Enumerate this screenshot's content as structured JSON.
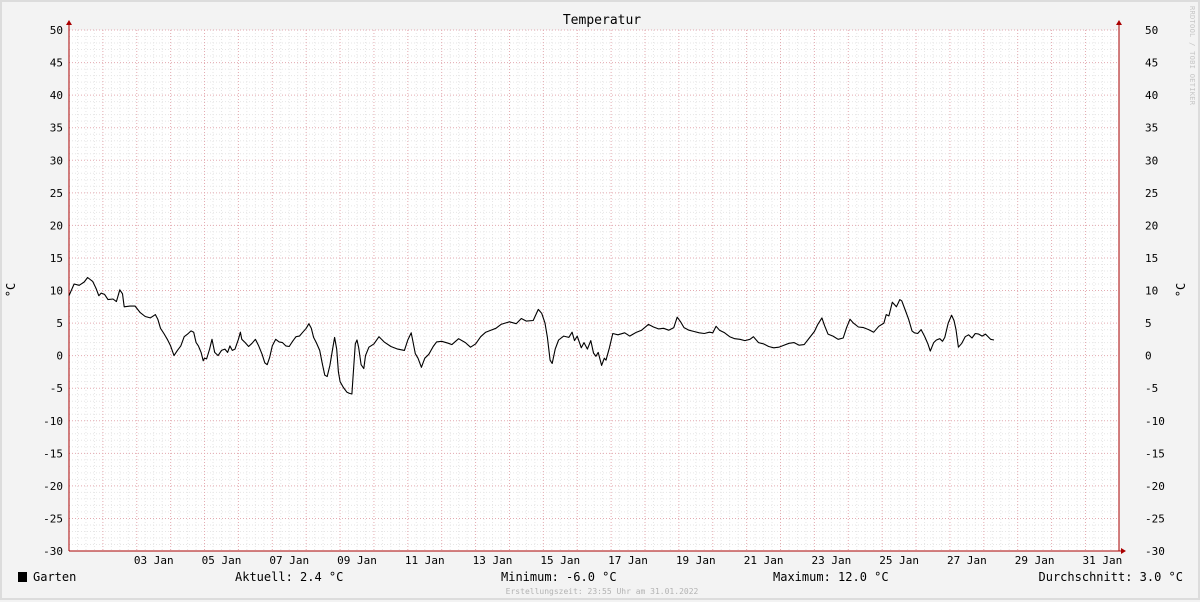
{
  "chart_data": {
    "type": "line",
    "title": "Temperatur",
    "ylabel": "°C",
    "y_ticks": [
      50,
      45,
      40,
      35,
      30,
      25,
      20,
      15,
      10,
      5,
      0,
      -5,
      -10,
      -15,
      -20,
      -25,
      -30
    ],
    "ylim": [
      -30,
      50
    ],
    "xlim": [
      1.0,
      31.99
    ],
    "x_ticks": [
      {
        "day": 3,
        "label": "03 Jan"
      },
      {
        "day": 5,
        "label": "05 Jan"
      },
      {
        "day": 7,
        "label": "07 Jan"
      },
      {
        "day": 9,
        "label": "09 Jan"
      },
      {
        "day": 11,
        "label": "11 Jan"
      },
      {
        "day": 13,
        "label": "13 Jan"
      },
      {
        "day": 15,
        "label": "15 Jan"
      },
      {
        "day": 17,
        "label": "17 Jan"
      },
      {
        "day": 19,
        "label": "19 Jan"
      },
      {
        "day": 21,
        "label": "21 Jan"
      },
      {
        "day": 23,
        "label": "23 Jan"
      },
      {
        "day": 25,
        "label": "25 Jan"
      },
      {
        "day": 27,
        "label": "27 Jan"
      },
      {
        "day": 29,
        "label": "29 Jan"
      },
      {
        "day": 31,
        "label": "31 Jan"
      }
    ],
    "grid": true,
    "series": [
      {
        "name": "Garten",
        "color": "#000000",
        "points": [
          [
            1.0,
            9.2
          ],
          [
            1.15,
            11.0
          ],
          [
            1.3,
            10.8
          ],
          [
            1.45,
            11.3
          ],
          [
            1.55,
            12.0
          ],
          [
            1.7,
            11.4
          ],
          [
            1.8,
            10.3
          ],
          [
            1.88,
            9.2
          ],
          [
            1.95,
            9.6
          ],
          [
            2.05,
            9.4
          ],
          [
            2.15,
            8.6
          ],
          [
            2.3,
            8.7
          ],
          [
            2.4,
            8.3
          ],
          [
            2.5,
            10.1
          ],
          [
            2.58,
            9.5
          ],
          [
            2.63,
            7.5
          ],
          [
            2.8,
            7.6
          ],
          [
            2.95,
            7.6
          ],
          [
            3.1,
            6.6
          ],
          [
            3.25,
            6.0
          ],
          [
            3.4,
            5.8
          ],
          [
            3.55,
            6.3
          ],
          [
            3.62,
            5.6
          ],
          [
            3.7,
            4.2
          ],
          [
            3.8,
            3.4
          ],
          [
            3.9,
            2.5
          ],
          [
            4.0,
            1.5
          ],
          [
            4.1,
            0.0
          ],
          [
            4.2,
            0.8
          ],
          [
            4.3,
            1.5
          ],
          [
            4.4,
            2.9
          ],
          [
            4.5,
            3.3
          ],
          [
            4.6,
            3.8
          ],
          [
            4.68,
            3.6
          ],
          [
            4.75,
            2.0
          ],
          [
            4.82,
            1.5
          ],
          [
            4.9,
            0.5
          ],
          [
            4.96,
            -0.8
          ],
          [
            5.0,
            -0.4
          ],
          [
            5.06,
            -0.5
          ],
          [
            5.15,
            1.0
          ],
          [
            5.22,
            2.5
          ],
          [
            5.3,
            0.5
          ],
          [
            5.4,
            0.0
          ],
          [
            5.5,
            0.8
          ],
          [
            5.6,
            1.0
          ],
          [
            5.68,
            0.5
          ],
          [
            5.75,
            1.5
          ],
          [
            5.82,
            0.8
          ],
          [
            5.9,
            1.0
          ],
          [
            6.0,
            2.5
          ],
          [
            6.06,
            3.6
          ],
          [
            6.1,
            2.5
          ],
          [
            6.2,
            2.0
          ],
          [
            6.3,
            1.4
          ],
          [
            6.4,
            1.9
          ],
          [
            6.5,
            2.5
          ],
          [
            6.6,
            1.5
          ],
          [
            6.7,
            0.2
          ],
          [
            6.78,
            -1.1
          ],
          [
            6.85,
            -1.4
          ],
          [
            6.92,
            -0.3
          ],
          [
            7.0,
            1.5
          ],
          [
            7.1,
            2.5
          ],
          [
            7.2,
            2.1
          ],
          [
            7.3,
            2.0
          ],
          [
            7.4,
            1.5
          ],
          [
            7.5,
            1.4
          ],
          [
            7.6,
            2.2
          ],
          [
            7.7,
            2.9
          ],
          [
            7.8,
            3.0
          ],
          [
            7.9,
            3.6
          ],
          [
            8.0,
            4.2
          ],
          [
            8.08,
            4.9
          ],
          [
            8.15,
            4.2
          ],
          [
            8.22,
            2.8
          ],
          [
            8.3,
            2.0
          ],
          [
            8.4,
            0.8
          ],
          [
            8.48,
            -1.3
          ],
          [
            8.55,
            -3.0
          ],
          [
            8.62,
            -3.2
          ],
          [
            8.7,
            -1.5
          ],
          [
            8.78,
            1.0
          ],
          [
            8.84,
            2.8
          ],
          [
            8.9,
            1.0
          ],
          [
            8.95,
            -2.5
          ],
          [
            9.0,
            -4.0
          ],
          [
            9.1,
            -4.9
          ],
          [
            9.2,
            -5.6
          ],
          [
            9.28,
            -5.8
          ],
          [
            9.35,
            -5.9
          ],
          [
            9.4,
            -2.0
          ],
          [
            9.45,
            1.8
          ],
          [
            9.5,
            2.4
          ],
          [
            9.55,
            1.2
          ],
          [
            9.62,
            -1.4
          ],
          [
            9.7,
            -2.0
          ],
          [
            9.75,
            0.0
          ],
          [
            9.85,
            1.3
          ],
          [
            10.0,
            1.8
          ],
          [
            10.15,
            2.9
          ],
          [
            10.3,
            2.1
          ],
          [
            10.5,
            1.4
          ],
          [
            10.7,
            1.0
          ],
          [
            10.9,
            0.8
          ],
          [
            11.0,
            2.4
          ],
          [
            11.1,
            3.5
          ],
          [
            11.15,
            2.2
          ],
          [
            11.22,
            0.3
          ],
          [
            11.3,
            -0.4
          ],
          [
            11.4,
            -1.8
          ],
          [
            11.5,
            -0.4
          ],
          [
            11.62,
            0.2
          ],
          [
            11.75,
            1.4
          ],
          [
            11.85,
            2.1
          ],
          [
            12.0,
            2.2
          ],
          [
            12.2,
            1.9
          ],
          [
            12.3,
            1.7
          ],
          [
            12.5,
            2.6
          ],
          [
            12.7,
            2.0
          ],
          [
            12.85,
            1.3
          ],
          [
            13.0,
            1.8
          ],
          [
            13.15,
            2.9
          ],
          [
            13.3,
            3.6
          ],
          [
            13.45,
            3.9
          ],
          [
            13.6,
            4.2
          ],
          [
            13.75,
            4.8
          ],
          [
            14.0,
            5.2
          ],
          [
            14.2,
            4.9
          ],
          [
            14.35,
            5.7
          ],
          [
            14.5,
            5.3
          ],
          [
            14.7,
            5.4
          ],
          [
            14.85,
            7.1
          ],
          [
            14.95,
            6.5
          ],
          [
            15.05,
            5.0
          ],
          [
            15.12,
            2.8
          ],
          [
            15.2,
            -0.7
          ],
          [
            15.26,
            -1.2
          ],
          [
            15.35,
            1.0
          ],
          [
            15.45,
            2.4
          ],
          [
            15.6,
            3.0
          ],
          [
            15.75,
            2.8
          ],
          [
            15.85,
            3.6
          ],
          [
            15.92,
            2.3
          ],
          [
            16.0,
            3.0
          ],
          [
            16.12,
            1.2
          ],
          [
            16.2,
            2.0
          ],
          [
            16.3,
            1.0
          ],
          [
            16.4,
            2.3
          ],
          [
            16.48,
            0.4
          ],
          [
            16.55,
            -0.1
          ],
          [
            16.62,
            0.5
          ],
          [
            16.72,
            -1.5
          ],
          [
            16.8,
            -0.4
          ],
          [
            16.85,
            -0.7
          ],
          [
            16.95,
            1.2
          ],
          [
            17.05,
            3.4
          ],
          [
            17.2,
            3.2
          ],
          [
            17.4,
            3.5
          ],
          [
            17.55,
            3.0
          ],
          [
            17.65,
            3.3
          ],
          [
            17.75,
            3.6
          ],
          [
            17.9,
            3.9
          ],
          [
            18.1,
            4.8
          ],
          [
            18.25,
            4.4
          ],
          [
            18.4,
            4.1
          ],
          [
            18.55,
            4.2
          ],
          [
            18.7,
            3.9
          ],
          [
            18.85,
            4.3
          ],
          [
            18.95,
            5.9
          ],
          [
            19.05,
            5.2
          ],
          [
            19.15,
            4.3
          ],
          [
            19.3,
            3.9
          ],
          [
            19.45,
            3.7
          ],
          [
            19.6,
            3.5
          ],
          [
            19.75,
            3.4
          ],
          [
            19.9,
            3.6
          ],
          [
            20.0,
            3.5
          ],
          [
            20.1,
            4.5
          ],
          [
            20.2,
            3.9
          ],
          [
            20.35,
            3.5
          ],
          [
            20.5,
            2.9
          ],
          [
            20.65,
            2.6
          ],
          [
            20.8,
            2.5
          ],
          [
            20.95,
            2.3
          ],
          [
            21.1,
            2.5
          ],
          [
            21.2,
            2.9
          ],
          [
            21.35,
            2.0
          ],
          [
            21.5,
            1.8
          ],
          [
            21.65,
            1.4
          ],
          [
            21.8,
            1.2
          ],
          [
            21.95,
            1.3
          ],
          [
            22.1,
            1.6
          ],
          [
            22.25,
            1.9
          ],
          [
            22.4,
            2.0
          ],
          [
            22.55,
            1.6
          ],
          [
            22.7,
            1.7
          ],
          [
            22.85,
            2.7
          ],
          [
            23.0,
            3.7
          ],
          [
            23.1,
            4.8
          ],
          [
            23.22,
            5.8
          ],
          [
            23.3,
            4.6
          ],
          [
            23.4,
            3.3
          ],
          [
            23.55,
            3.0
          ],
          [
            23.7,
            2.5
          ],
          [
            23.85,
            2.7
          ],
          [
            23.95,
            4.3
          ],
          [
            24.05,
            5.6
          ],
          [
            24.15,
            5.0
          ],
          [
            24.3,
            4.4
          ],
          [
            24.45,
            4.3
          ],
          [
            24.6,
            4.0
          ],
          [
            24.75,
            3.6
          ],
          [
            24.9,
            4.5
          ],
          [
            25.05,
            5.0
          ],
          [
            25.12,
            6.3
          ],
          [
            25.2,
            6.1
          ],
          [
            25.3,
            8.2
          ],
          [
            25.42,
            7.5
          ],
          [
            25.52,
            8.6
          ],
          [
            25.58,
            8.4
          ],
          [
            25.68,
            7.0
          ],
          [
            25.78,
            5.6
          ],
          [
            25.88,
            3.8
          ],
          [
            25.95,
            3.5
          ],
          [
            26.05,
            3.4
          ],
          [
            26.15,
            4.0
          ],
          [
            26.25,
            3.0
          ],
          [
            26.35,
            1.8
          ],
          [
            26.42,
            0.7
          ],
          [
            26.52,
            2.0
          ],
          [
            26.6,
            2.4
          ],
          [
            26.7,
            2.6
          ],
          [
            26.78,
            2.2
          ],
          [
            26.85,
            2.8
          ],
          [
            26.95,
            5.0
          ],
          [
            27.05,
            6.2
          ],
          [
            27.12,
            5.4
          ],
          [
            27.18,
            4.0
          ],
          [
            27.25,
            1.3
          ],
          [
            27.35,
            1.9
          ],
          [
            27.45,
            2.9
          ],
          [
            27.55,
            3.2
          ],
          [
            27.65,
            2.7
          ],
          [
            27.75,
            3.4
          ],
          [
            27.85,
            3.3
          ],
          [
            27.95,
            3.0
          ],
          [
            28.05,
            3.3
          ],
          [
            28.2,
            2.5
          ],
          [
            28.3,
            2.4
          ]
        ]
      }
    ]
  },
  "legend": {
    "series_name": "Garten",
    "current": "Aktuell: 2.4 °C",
    "minimum": "Minimum: -6.0 °C",
    "maximum": "Maximum: 12.0 °C",
    "average": "Durchschnitt: 3.0 °C"
  },
  "footer": {
    "timestamp": "Erstellungszeit: 23:55 Uhr am 31.01.2022"
  },
  "watermark": "RRDTOOL / TOBI OETIKER"
}
